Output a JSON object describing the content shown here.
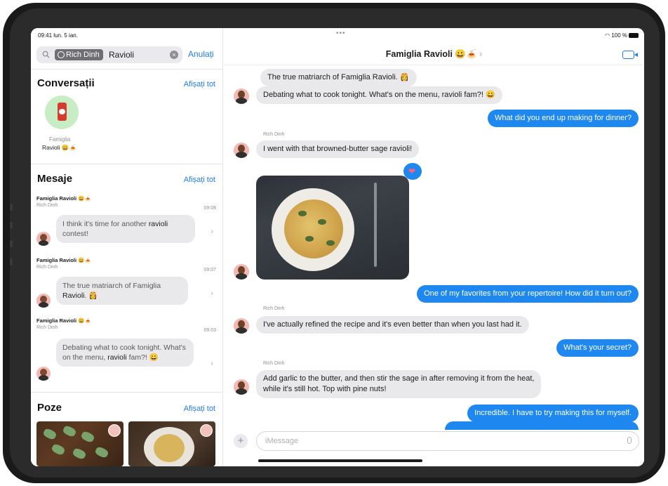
{
  "status_bar": {
    "time_date": "09:41 lun. 5 ian.",
    "battery": "100 %"
  },
  "search": {
    "token": "Rich Dinh",
    "query": "Ravioli",
    "cancel_label": "Anulați"
  },
  "conversations": {
    "title": "Conversații",
    "see_all": "Afișați tot",
    "group_name_line1": "Famiglia",
    "group_name_line2": "Ravioli 😀🍝"
  },
  "messages": {
    "title": "Mesaje",
    "see_all": "Afișați tot",
    "results": [
      {
        "group": "Famiglia Ravioli 😀🍝",
        "sender": "Rich Dinh",
        "time": "09:08",
        "text_before": "I think it's time for another ",
        "keyword": "ravioli",
        "text_after": " contest!"
      },
      {
        "group": "Famiglia Ravioli 😀🍝",
        "sender": "Rich Dinh",
        "time": "09:07",
        "text_before": "The true matriarch of Famiglia ",
        "keyword": "Ravioli",
        "text_after": ". 👸"
      },
      {
        "group": "Famiglia Ravioli 😀🍝",
        "sender": "Rich Dinh",
        "time": "09:03",
        "text_before": "Debating what to cook tonight. What's on the menu, ",
        "keyword": "ravioli",
        "text_after": " fam?! 😀"
      }
    ]
  },
  "photos": {
    "title": "Poze",
    "see_all": "Afișați tot"
  },
  "conversation": {
    "title": "Famiglia Ravioli 😀🍝",
    "sender_name": "Rich Dinh",
    "msg1": "The true matriarch of Famiglia Ravioli. 👸",
    "msg2": "Debating what to cook tonight. What's on the menu, ravioli fam?! 😀",
    "msg3": "What did you end up making for dinner?",
    "msg4": "I went with that browned-butter sage ravioli!",
    "tapback": "❤",
    "msg5": "One of my favorites from your repertoire! How did it turn out?",
    "msg6": "I've actually refined the recipe and it's even better than when you last had it.",
    "msg7": "What's your secret?",
    "msg8_line1": "Add garlic to the butter, and then stir the sage in after removing it from the heat,",
    "msg8_line2": "while it's still hot. Top with pine nuts!",
    "msg9": "Incredible. I have to try making this for myself.",
    "input_placeholder": "iMessage"
  },
  "colors": {
    "accent": "#1e7cf2",
    "bubble_out": "#1e88f0",
    "bubble_in": "#e9e9eb"
  },
  "icons": [
    "search-icon",
    "clear-icon",
    "video-icon",
    "plus-icon",
    "mic-icon",
    "chevron-right-icon"
  ]
}
